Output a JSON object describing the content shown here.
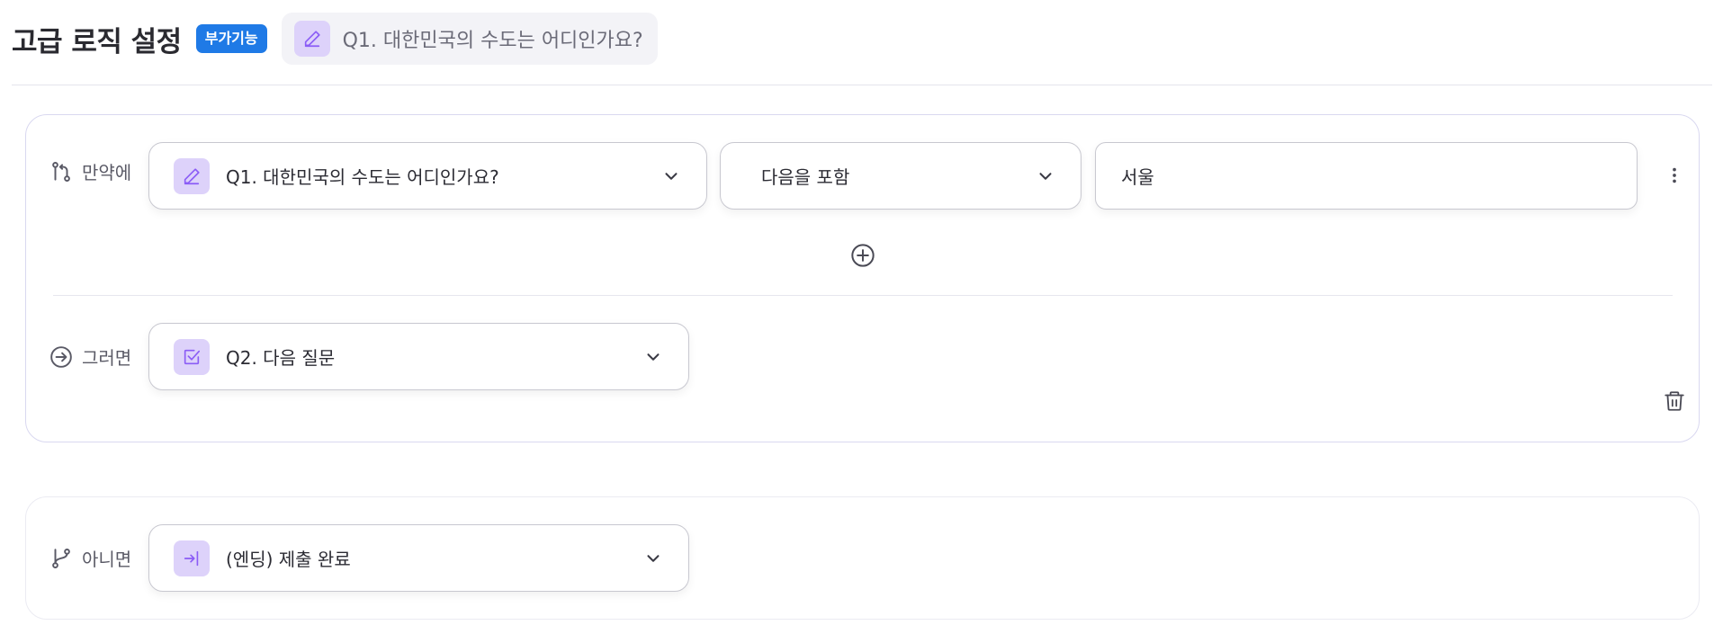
{
  "header": {
    "title": "고급 로직 설정",
    "badge": "부가기능",
    "question_chip": "Q1. 대한민국의 수도는 어디인가요?"
  },
  "logic": {
    "if_label": "만약에",
    "condition": {
      "question": "Q1. 대한민국의 수도는 어디인가요?",
      "operator": "다음을 포함",
      "value": "서울"
    },
    "then_label": "그러면",
    "then_target": "Q2. 다음 질문",
    "else_label": "아니면",
    "else_target": "(엔딩) 제출 완료"
  },
  "icons": {
    "question_type": "pencil-icon",
    "then_type": "checkbox-icon",
    "else_type": "exit-icon",
    "if": "git-compare-icon",
    "then": "arrow-circle-right-icon",
    "else": "git-branch-icon",
    "add": "plus-circle-icon",
    "more": "more-vertical-icon",
    "delete": "trash-icon"
  },
  "colors": {
    "accent": "#1f7ae6",
    "tile_bg": "#ddd2fa",
    "tile_icon": "#8b5cf6"
  }
}
